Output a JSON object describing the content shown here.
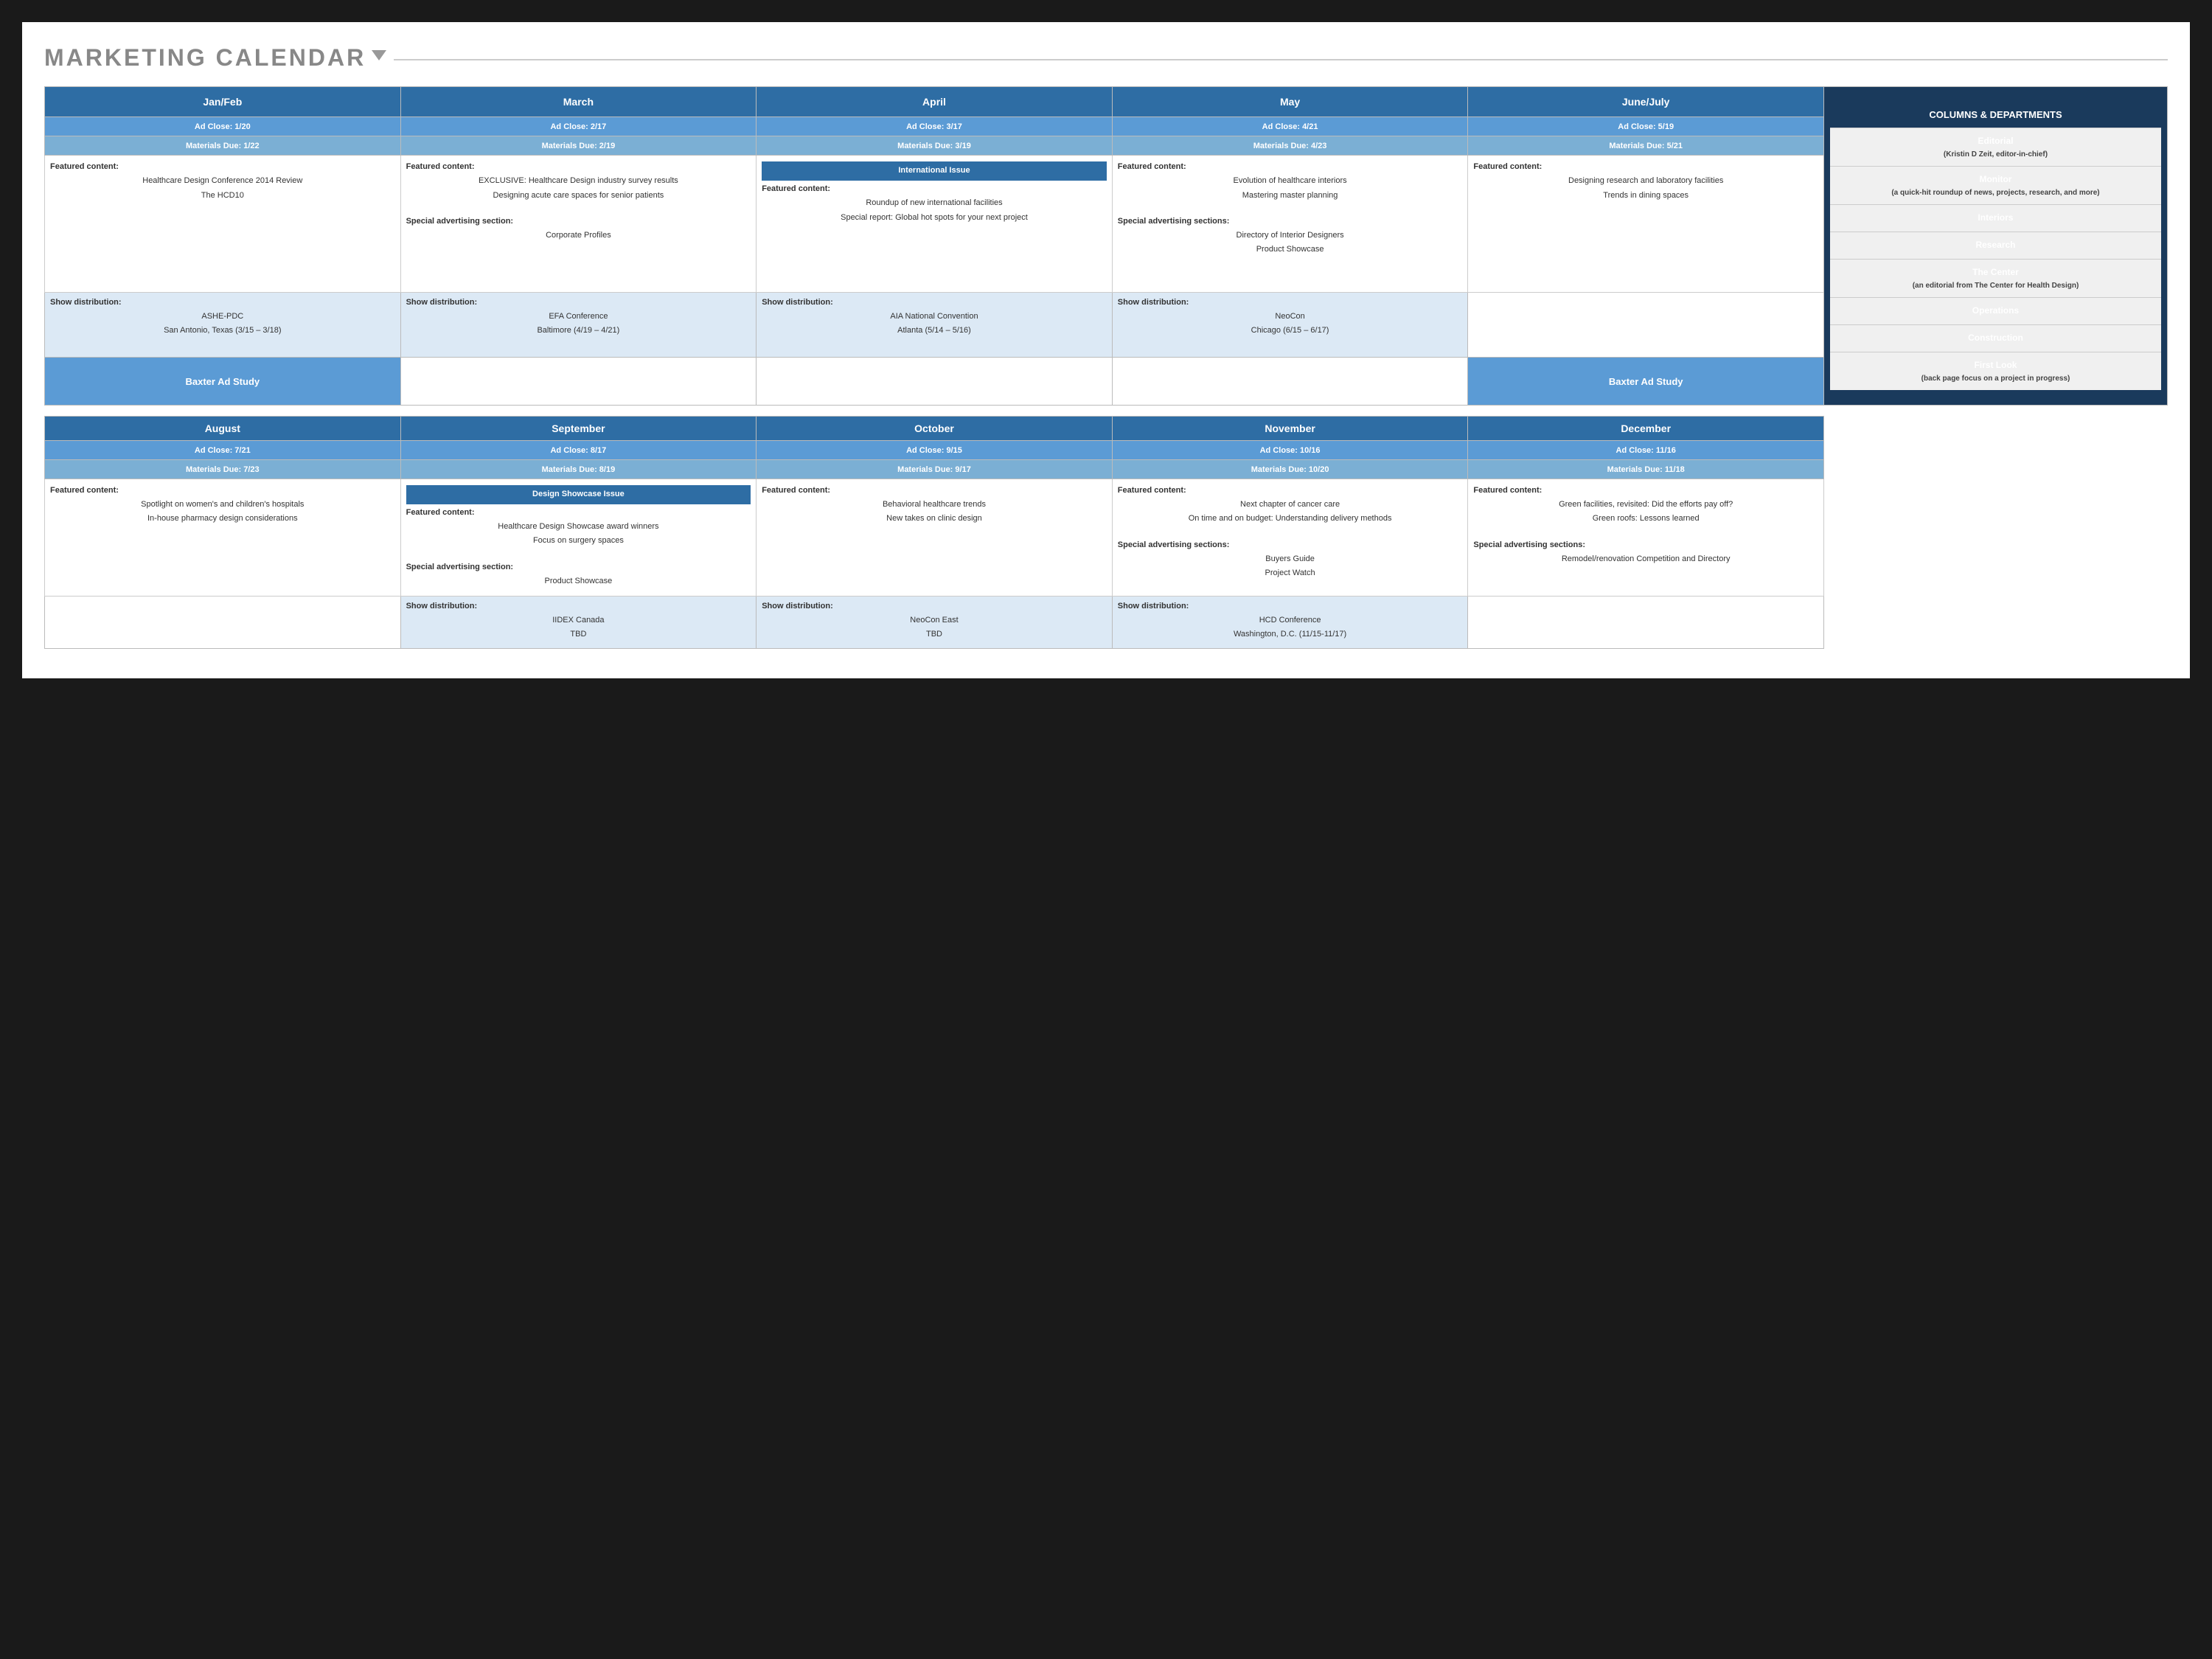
{
  "title": "MARKETING CALENDAR",
  "months_row1": [
    {
      "name": "Jan/Feb",
      "ad_close": "Ad Close: 1/20",
      "materials_due": "Materials Due: 1/22",
      "featured_label": "Featured content:",
      "featured_items": [
        "Healthcare Design Conference 2014 Review",
        "The HCD10"
      ],
      "show_label": "Show distribution:",
      "show_items": [
        "ASHE-PDC",
        "San Antonio, Texas (3/15 – 3/18)"
      ],
      "special_label": "",
      "special_items": [],
      "baxter": "Baxter Ad Study",
      "intl_issue": false,
      "design_showcase": false
    },
    {
      "name": "March",
      "ad_close": "Ad Close: 2/17",
      "materials_due": "Materials Due: 2/19",
      "featured_label": "Featured content:",
      "featured_items": [
        "EXCLUSIVE: Healthcare Design industry survey results",
        "Designing acute care spaces for senior patients"
      ],
      "show_label": "Show distribution:",
      "show_items": [
        "EFA Conference",
        "Baltimore (4/19 – 4/21)"
      ],
      "special_label": "Special advertising section:",
      "special_items": [
        "Corporate Profiles"
      ],
      "baxter": "",
      "intl_issue": false,
      "design_showcase": false
    },
    {
      "name": "April",
      "ad_close": "Ad Close: 3/17",
      "materials_due": "Materials Due: 3/19",
      "featured_label": "Featured content:",
      "featured_items": [
        "Roundup of new international facilities",
        "Special report: Global hot spots for your next project"
      ],
      "show_label": "Show distribution:",
      "show_items": [
        "AIA National Convention",
        "Atlanta (5/14 – 5/16)"
      ],
      "special_label": "",
      "special_items": [],
      "baxter": "",
      "intl_issue": true,
      "design_showcase": false
    },
    {
      "name": "May",
      "ad_close": "Ad Close: 4/21",
      "materials_due": "Materials Due: 4/23",
      "featured_label": "Featured content:",
      "featured_items": [
        "Evolution of healthcare interiors",
        "Mastering master planning"
      ],
      "show_label": "Show distribution:",
      "show_items": [
        "NeoCon",
        "Chicago (6/15 – 6/17)"
      ],
      "special_label": "Special advertising sections:",
      "special_items": [
        "Directory of Interior Designers",
        "Product Showcase"
      ],
      "baxter": "",
      "intl_issue": false,
      "design_showcase": false
    },
    {
      "name": "June/July",
      "ad_close": "Ad Close: 5/19",
      "materials_due": "Materials Due: 5/21",
      "featured_label": "Featured content:",
      "featured_items": [
        "Designing research and laboratory facilities",
        "Trends in dining spaces"
      ],
      "show_label": "",
      "show_items": [],
      "special_label": "",
      "special_items": [],
      "baxter": "Baxter Ad Study",
      "intl_issue": false,
      "design_showcase": false
    }
  ],
  "months_row2": [
    {
      "name": "August",
      "ad_close": "Ad Close: 7/21",
      "materials_due": "Materials Due: 7/23",
      "featured_label": "Featured content:",
      "featured_items": [
        "Spotlight on women's and children's hospitals",
        "In-house pharmacy design considerations"
      ],
      "show_label": "",
      "show_items": [],
      "special_label": "",
      "special_items": [],
      "baxter": "",
      "intl_issue": false,
      "design_showcase": false
    },
    {
      "name": "September",
      "ad_close": "Ad Close: 8/17",
      "materials_due": "Materials Due: 8/19",
      "featured_label": "Featured content:",
      "featured_items": [
        "Healthcare Design Showcase award winners",
        "Focus on surgery spaces"
      ],
      "show_label": "Show distribution:",
      "show_items": [
        "IIDEX Canada",
        "TBD"
      ],
      "special_label": "Special advertising section:",
      "special_items": [
        "Product Showcase"
      ],
      "baxter": "",
      "intl_issue": false,
      "design_showcase": true
    },
    {
      "name": "October",
      "ad_close": "Ad Close: 9/15",
      "materials_due": "Materials Due: 9/17",
      "featured_label": "Featured content:",
      "featured_items": [
        "Behavioral healthcare trends",
        "New takes on clinic design"
      ],
      "show_label": "Show distribution:",
      "show_items": [
        "NeoCon East",
        "TBD"
      ],
      "special_label": "",
      "special_items": [],
      "baxter": "",
      "intl_issue": false,
      "design_showcase": false
    },
    {
      "name": "November",
      "ad_close": "Ad Close: 10/16",
      "materials_due": "Materials Due: 10/20",
      "featured_label": "Featured content:",
      "featured_items": [
        "Next chapter of cancer care",
        "On time and on budget: Understanding delivery methods"
      ],
      "show_label": "Show distribution:",
      "show_items": [
        "HCD Conference",
        "Washington, D.C. (11/15-11/17)"
      ],
      "special_label": "Special advertising sections:",
      "special_items": [
        "Buyers Guide",
        "Project Watch"
      ],
      "baxter": "",
      "intl_issue": false,
      "design_showcase": false
    },
    {
      "name": "December",
      "ad_close": "Ad Close: 11/16",
      "materials_due": "Materials Due: 11/18",
      "featured_label": "Featured content:",
      "featured_items": [
        "Green facilities, revisited: Did the efforts pay off?",
        "Green roofs: Lessons learned"
      ],
      "show_label": "",
      "show_items": [],
      "special_label": "Special advertising sections:",
      "special_items": [
        "Remodel/renovation Competition and Directory"
      ],
      "baxter": "",
      "intl_issue": false,
      "design_showcase": false
    }
  ],
  "sidebar": {
    "header": "COLUMNS & DEPARTMENTS",
    "items": [
      {
        "title": "Editorial",
        "sub": "(Kristin D Zeit, editor-in-chief)"
      },
      {
        "title": "Monitor",
        "sub": "(a quick-hit roundup of news, projects, research, and more)"
      },
      {
        "title": "Interiors",
        "sub": ""
      },
      {
        "title": "Research",
        "sub": ""
      },
      {
        "title": "The Center",
        "sub": "(an editorial from The Center for Health Design)"
      },
      {
        "title": "Operations",
        "sub": ""
      },
      {
        "title": "Construction",
        "sub": ""
      },
      {
        "title": "First Look",
        "sub": "(back page focus on a project in progress)"
      }
    ]
  }
}
